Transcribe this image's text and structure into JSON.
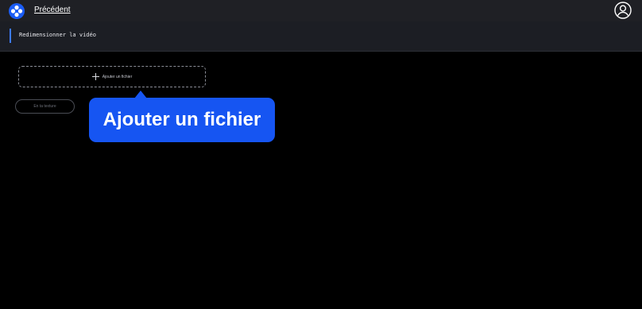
{
  "header": {
    "back_label": "Précédent",
    "logo_icon": "app-logo-icon",
    "user_icon": "user-account-icon"
  },
  "subheader": {
    "title": "Redimensionner la vidéo",
    "accent_color": "#3d7bff"
  },
  "main": {
    "add_file_label": "Ajouter un fichier",
    "add_file_icon": "plus-icon",
    "secondary_button_label": "En ta texture"
  },
  "tooltip": {
    "text": "Ajouter un fichier",
    "color": "#1655f2"
  }
}
